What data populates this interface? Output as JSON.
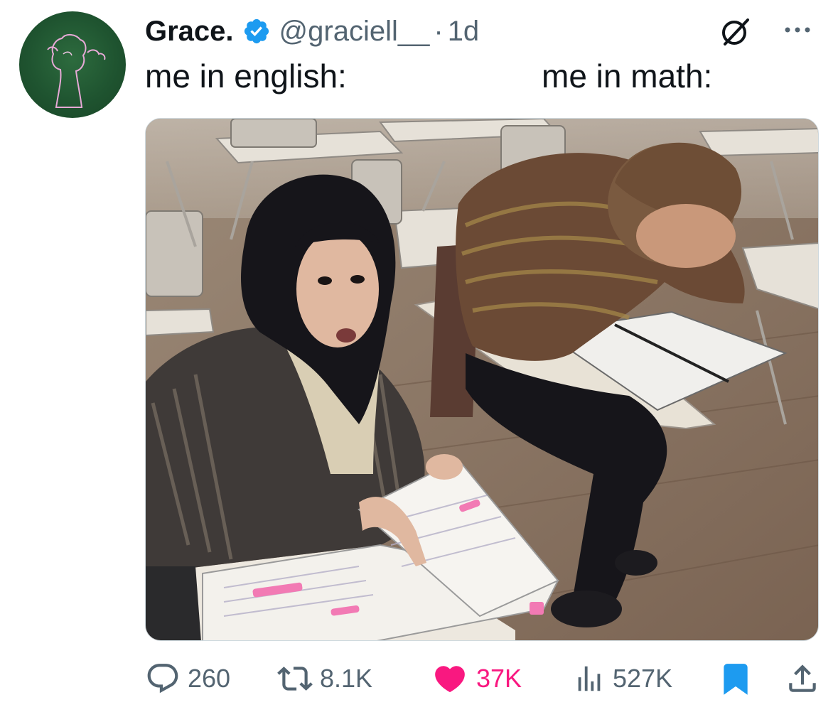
{
  "tweet": {
    "author_name": "Grace.",
    "handle": "@graciell__",
    "separator": "·",
    "time_ago": "1d",
    "caption_left": "me in english:",
    "caption_right": "me in math:"
  },
  "stats": {
    "replies": "260",
    "retweets": "8.1K",
    "likes": "37K",
    "views": "527K"
  },
  "icons": {
    "verified": "verified-badge-icon",
    "grok": "grok-icon",
    "more": "more-icon",
    "reply": "reply-icon",
    "retweet": "retweet-icon",
    "like": "heart-icon",
    "views": "views-chart-icon",
    "bookmark": "bookmark-icon",
    "share": "share-icon"
  },
  "colors": {
    "verified_blue": "#1d9bf0",
    "like_pink": "#f91880",
    "secondary_text": "#536471",
    "avatar_green": "#1f5430"
  }
}
